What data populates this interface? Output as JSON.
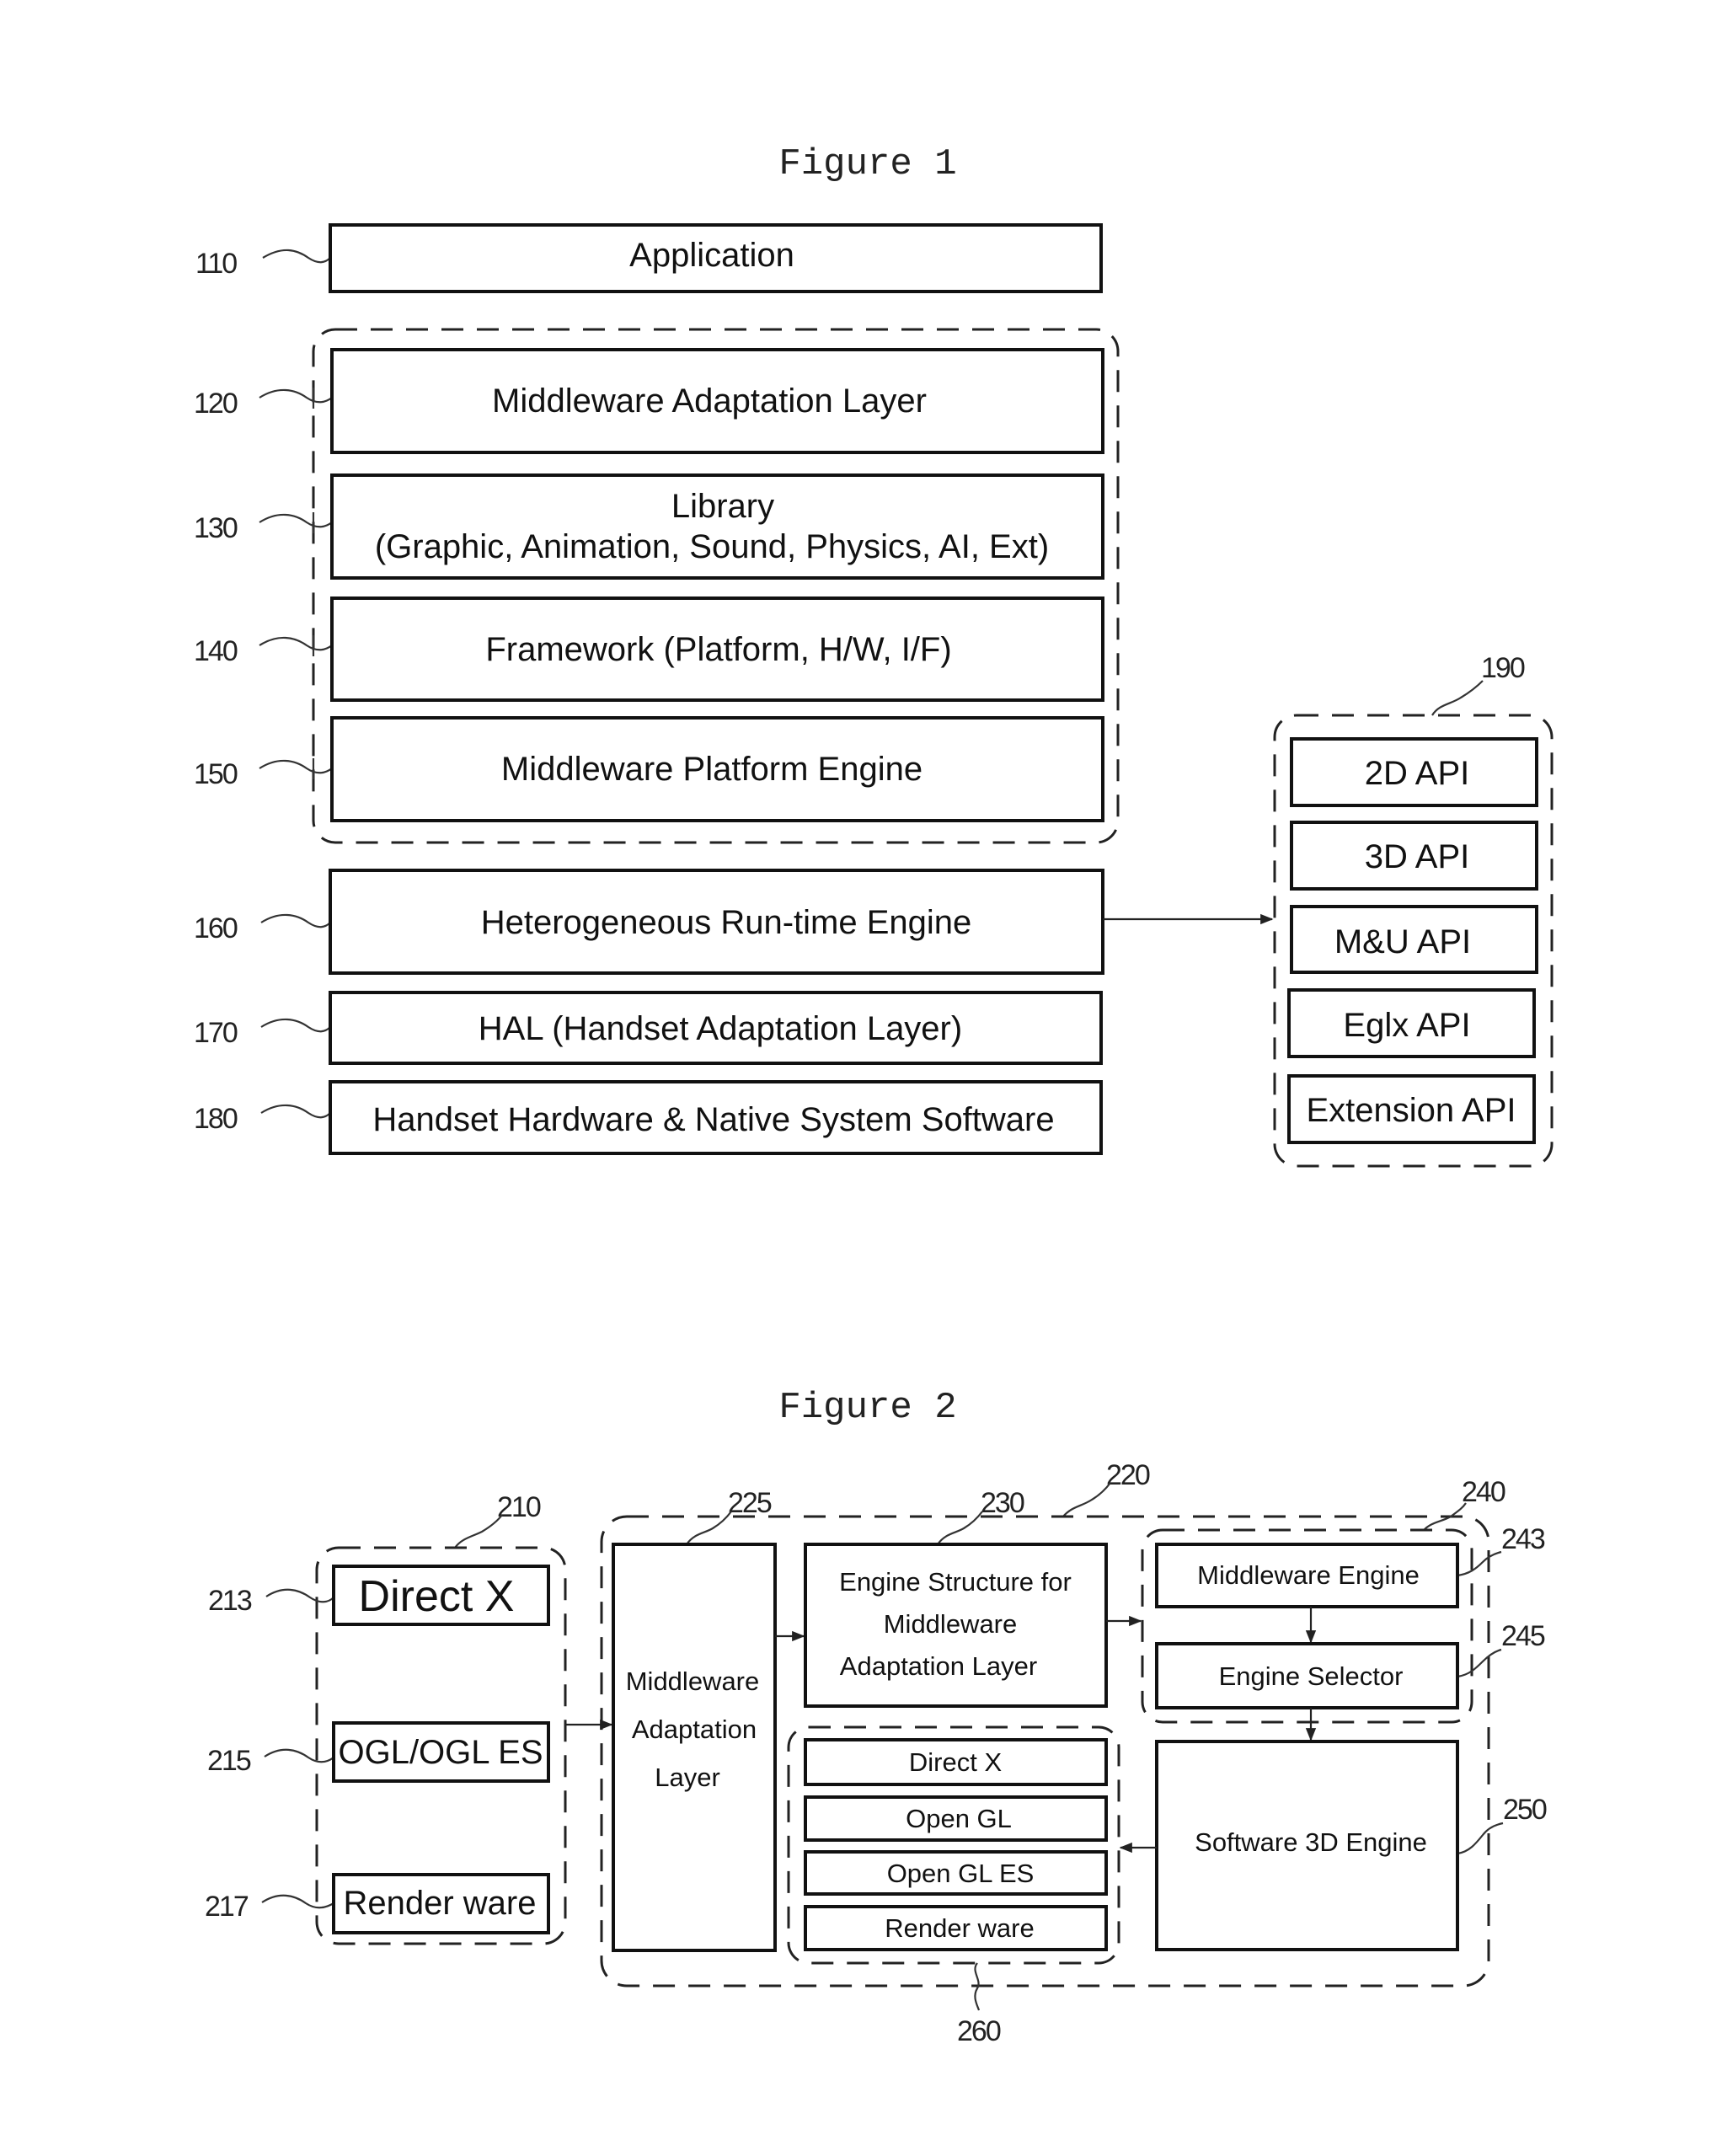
{
  "figure1": {
    "title": "Figure 1",
    "layers": [
      {
        "ref": "110",
        "label": "Application"
      },
      {
        "ref": "120",
        "label": "Middleware Adaptation Layer"
      },
      {
        "ref": "130",
        "label_line1": "Library",
        "label_line2": "(Graphic, Animation, Sound, Physics, AI, Ext)"
      },
      {
        "ref": "140",
        "label": "Framework (Platform, H/W, I/F)"
      },
      {
        "ref": "150",
        "label": "Middleware Platform Engine"
      },
      {
        "ref": "160",
        "label": "Heterogeneous Run-time Engine"
      },
      {
        "ref": "170",
        "label": "HAL (Handset Adaptation Layer)"
      },
      {
        "ref": "180",
        "label": "Handset Hardware  &  Native System Software"
      }
    ],
    "api_group": {
      "ref": "190",
      "items": [
        "2D API",
        "3D API",
        "M&U API",
        "Eglx API",
        "Extension API"
      ]
    }
  },
  "figure2": {
    "title": "Figure 2",
    "external_group": {
      "ref": "210",
      "items": [
        {
          "ref": "213",
          "label": "Direct X"
        },
        {
          "ref": "215",
          "label": "OGL/OGL ES"
        },
        {
          "ref": "217",
          "label": "Render ware"
        }
      ]
    },
    "middleware_group": {
      "ref": "220",
      "adaptation_layer": {
        "ref": "225",
        "line1": "Middleware",
        "line2": "Adaptation",
        "line3": "Layer"
      },
      "engine_structure": {
        "ref": "230",
        "line1": "Engine Structure for",
        "line2": "Middleware",
        "line3": "Adaptation Layer"
      },
      "engine_group": {
        "ref": "240",
        "middleware_engine": {
          "ref": "243",
          "label": "Middleware Engine"
        },
        "engine_selector": {
          "ref": "245",
          "label": "Engine Selector"
        }
      },
      "software_3d_engine": {
        "ref": "250",
        "label": "Software 3D Engine"
      },
      "api_group": {
        "ref": "260",
        "items": [
          "Direct X",
          "Open GL",
          "Open GL ES",
          "Render ware"
        ]
      }
    }
  }
}
